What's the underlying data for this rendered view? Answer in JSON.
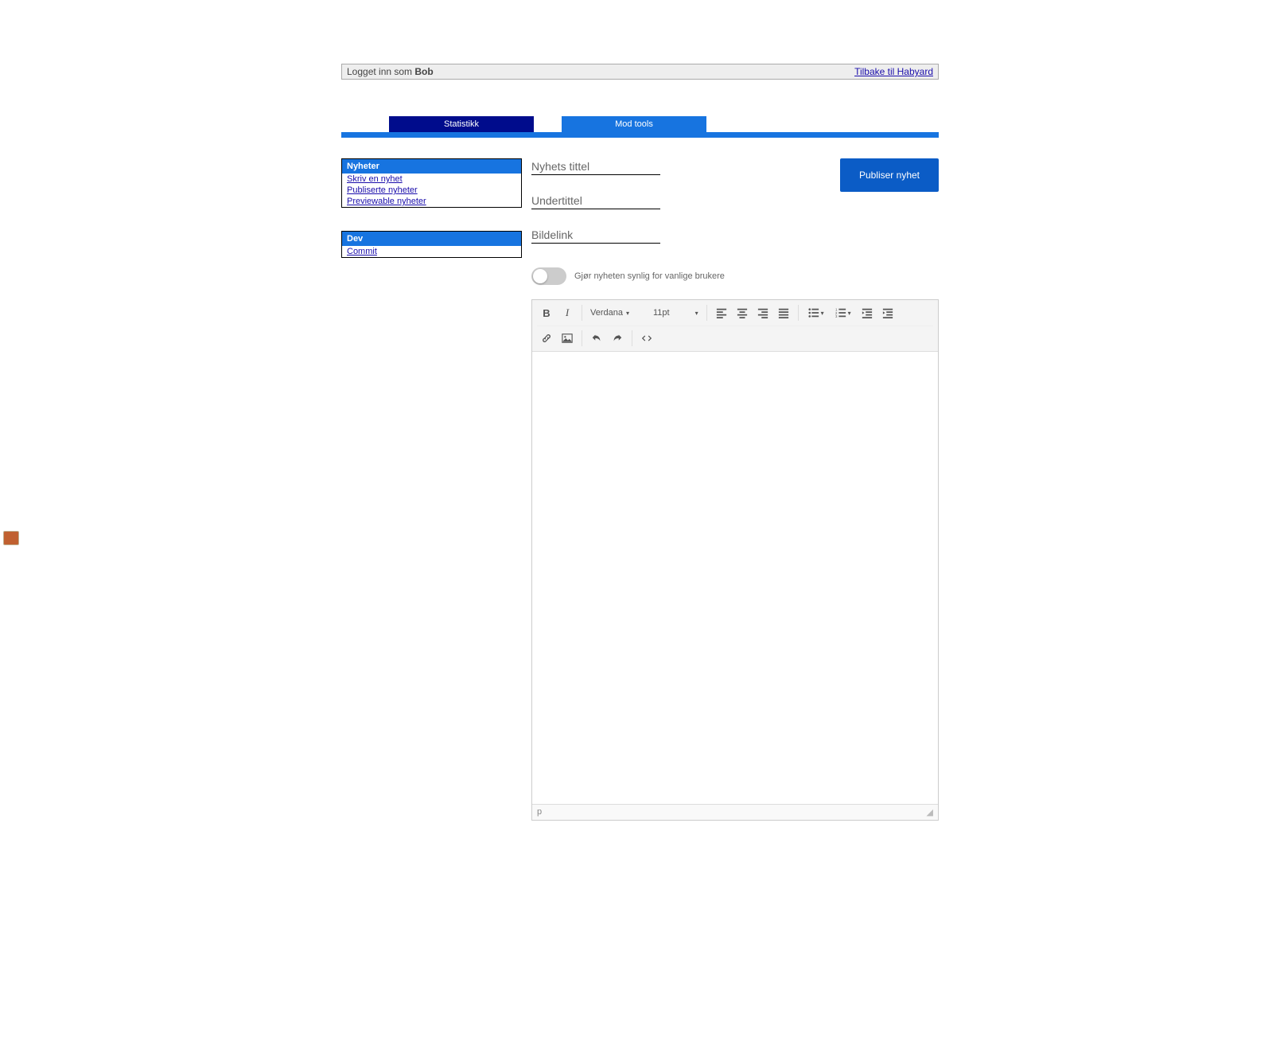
{
  "topbar": {
    "logged_in_prefix": "Logget inn som ",
    "username": "Bob",
    "back_link": "Tilbake til Habyard"
  },
  "tabs": {
    "statistikk": "Statistikk",
    "mod_tools": "Mod tools"
  },
  "sidebar": {
    "nyheter": {
      "title": "Nyheter",
      "links": {
        "skriv": "Skriv en nyhet",
        "publiserte": "Publiserte nyheter",
        "previewable": "Previewable nyheter"
      }
    },
    "dev": {
      "title": "Dev",
      "links": {
        "commit": "Commit"
      }
    }
  },
  "form": {
    "title_placeholder": "Nyhets tittel",
    "subtitle_placeholder": "Undertittel",
    "imagelink_placeholder": "Bildelink",
    "toggle_label": "Gjør nyheten synlig for vanlige brukere",
    "publish_label": "Publiser nyhet"
  },
  "editor": {
    "font_family": "Verdana",
    "font_size": "11pt",
    "status_path": "p"
  }
}
